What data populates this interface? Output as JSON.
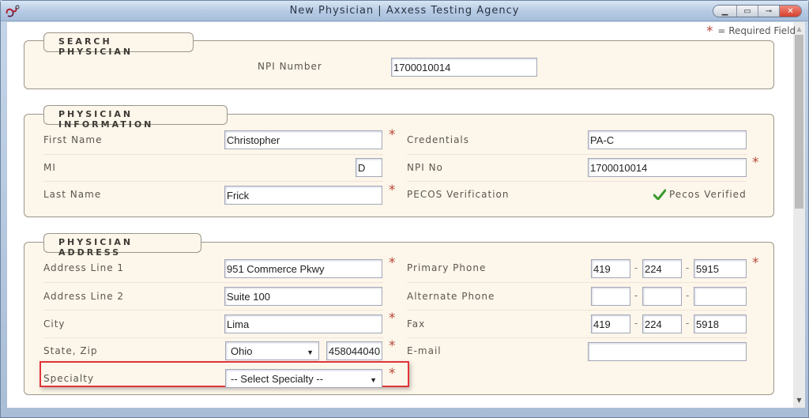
{
  "window": {
    "title": "New Physician | Axxess Testing Agency",
    "controls": {
      "minimize": "minimize-icon",
      "maximize": "maximize-icon",
      "pin": "pin-icon",
      "close": "close-icon"
    }
  },
  "required_note": {
    "symbol": "*",
    "text": "= Required Field"
  },
  "search_physician": {
    "legend": "Search Physician",
    "npi_label": "NPI Number",
    "npi_value": "1700010014"
  },
  "physician_information": {
    "legend": "Physician Information",
    "first_name_label": "First Name",
    "first_name_value": "Christopher",
    "mi_label": "MI",
    "mi_value": "D",
    "last_name_label": "Last Name",
    "last_name_value": "Frick",
    "credentials_label": "Credentials",
    "credentials_value": "PA-C",
    "npi_no_label": "NPI No",
    "npi_no_value": "1700010014",
    "pecos_label": "PECOS Verification",
    "pecos_status": "Pecos Verified"
  },
  "physician_address": {
    "legend": "Physician Address",
    "address1_label": "Address Line 1",
    "address1_value": "951 Commerce Pkwy",
    "address2_label": "Address Line 2",
    "address2_value": "Suite 100",
    "city_label": "City",
    "city_value": "Lima",
    "state_zip_label": "State, Zip",
    "state_value": "Ohio",
    "zip_value": "458044040",
    "specialty_label": "Specialty",
    "specialty_value": "-- Select Specialty --",
    "primary_phone_label": "Primary Phone",
    "primary_phone": [
      "419",
      "224",
      "5915"
    ],
    "alternate_phone_label": "Alternate Phone",
    "alternate_phone": [
      "",
      "",
      ""
    ],
    "fax_label": "Fax",
    "fax": [
      "419",
      "224",
      "5918"
    ],
    "email_label": "E-mail",
    "email_value": "",
    "phone_separator": "-"
  },
  "colors": {
    "required": "#b5483c",
    "highlight": "#e0353a",
    "fieldset_bg": "#fdf6ea",
    "verified_check": "#3a9a2e"
  }
}
